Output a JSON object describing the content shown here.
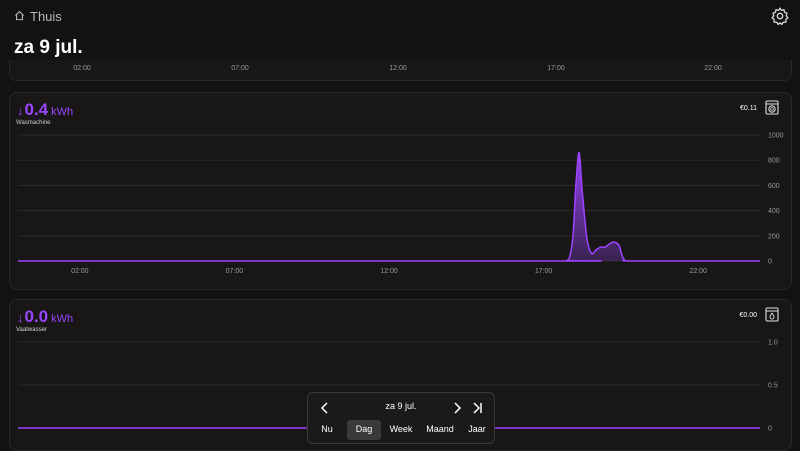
{
  "header": {
    "home_label": "Thuis",
    "date_title": "za 9 jul."
  },
  "timeline": {
    "ticks": [
      "02:00",
      "07:00",
      "12:00",
      "17:00",
      "22:00"
    ]
  },
  "cards": [
    {
      "device": "Wasmachine",
      "value": "0.4",
      "unit": "kWh",
      "cost": "€0.11",
      "icon": "washing-machine-icon",
      "direction_icon": "arrow-down-icon",
      "y_ticks": [
        "1000",
        "800",
        "600",
        "400",
        "200",
        "0"
      ],
      "x_ticks": [
        "02:00",
        "07:00",
        "12:00",
        "17:00",
        "22:00"
      ]
    },
    {
      "device": "Vaatwasser",
      "value": "0.0",
      "unit": "kWh",
      "cost": "€0.00",
      "icon": "dishwasher-icon",
      "direction_icon": "arrow-down-icon",
      "y_ticks": [
        "1.0",
        "0.5",
        "0"
      ]
    }
  ],
  "date_nav": {
    "date": "za 9 jul.",
    "tabs": [
      "Nu",
      "Dag",
      "Week",
      "Maand",
      "Jaar"
    ],
    "active_tab": "Dag"
  },
  "colors": {
    "accent": "#9b44ff",
    "background": "#131210",
    "card": "#181715"
  },
  "chart_data": [
    {
      "type": "area",
      "title": "Wasmachine",
      "xlabel": "",
      "ylabel": "",
      "x_unit": "hour of day",
      "ylim": [
        0,
        1000
      ],
      "x": [
        0,
        17.5,
        17.75,
        17.85,
        17.95,
        18.05,
        18.15,
        18.25,
        18.4,
        18.55,
        18.7,
        18.85,
        19.0,
        19.15,
        19.3,
        19.45,
        19.6,
        20.0,
        24
      ],
      "y": [
        0,
        0,
        5,
        40,
        200,
        620,
        860,
        560,
        180,
        60,
        90,
        110,
        110,
        140,
        150,
        120,
        15,
        0,
        0
      ],
      "grid": true
    },
    {
      "type": "line",
      "title": "Vaatwasser",
      "xlabel": "",
      "ylabel": "",
      "ylim": [
        0,
        1.0
      ],
      "x": [
        0,
        24
      ],
      "y": [
        0,
        0
      ],
      "grid": true
    }
  ]
}
